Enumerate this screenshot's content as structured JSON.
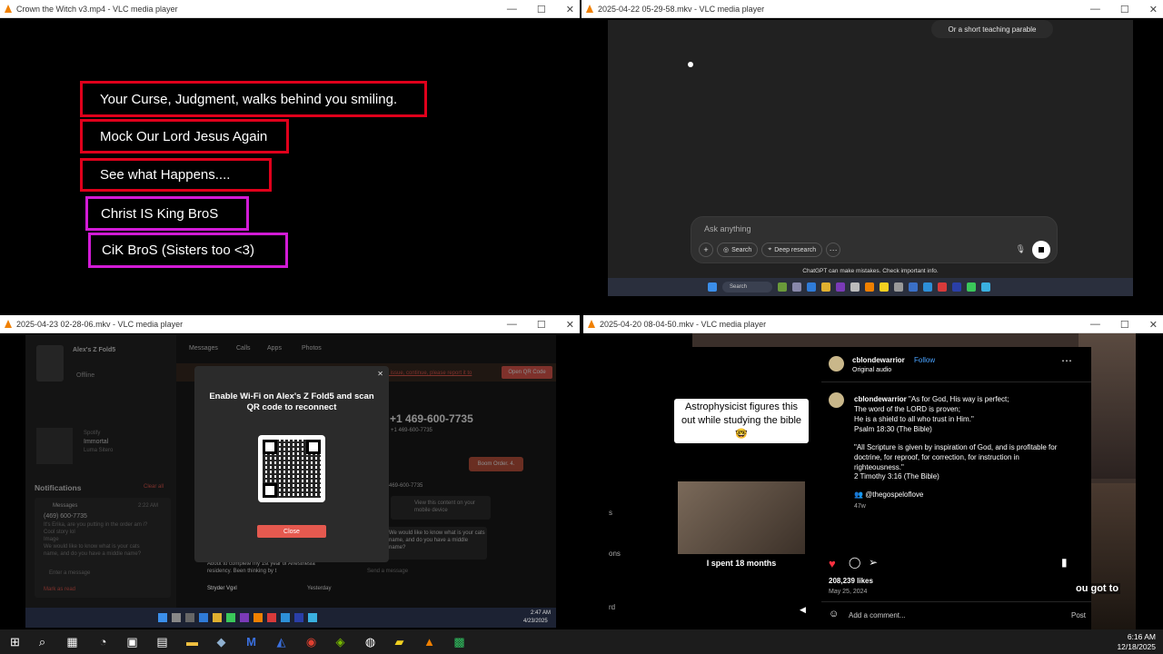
{
  "windows": {
    "w1": {
      "title": "Crown the Witch v3.mp4 - VLC media player",
      "lines": [
        "Your Curse, Judgment, walks behind you smiling.",
        "Mock Our Lord Jesus Again",
        "See what Happens....",
        "Christ IS King BroS",
        "CiK BroS (Sisters too <3)"
      ]
    },
    "w2": {
      "title": "2025-04-22 05-29-58.mkv - VLC media player",
      "tooltip": "Or a short teaching parable",
      "ask_placeholder": "Ask anything",
      "search_label": "Search",
      "deep_research_label": "Deep research",
      "disclaimer": "ChatGPT can make mistakes. Check important info.",
      "taskbar_search": "Search"
    },
    "w3": {
      "title": "2025-04-23 02-28-06.mkv - VLC media player",
      "device_name": "Alex's Z Fold5",
      "status": "Offline",
      "tabs": [
        "Messages",
        "Calls",
        "Apps",
        "Photos"
      ],
      "now_playing_source": "Spotify",
      "now_playing_title": "Immortal",
      "now_playing_artist": "Luma Sitero",
      "notifications_header": "Notifications",
      "clear_all": "Clear all",
      "notif_app": "Messages",
      "notif_time": "2:22 AM",
      "notif_sender": "(469) 600-7735",
      "notif_lines": [
        "It's Erika, are you putting in the order am i?",
        "Cool story lol",
        "Image",
        "We would like to know what is your cats",
        "name, and do you have a middle name?"
      ],
      "enter_message": "Enter a message",
      "mark_as_read": "Mark as read",
      "banner_link": "Fix issue, continue, please report it to",
      "qr_button": "Open QR Code",
      "dialog_text": "Enable Wi-Fi on Alex's Z Fold5 and scan QR code to reconnect",
      "dialog_close": "Close",
      "contact_number": "+1 469-600-7735",
      "contact_sub": "+1 469-600-7735",
      "bubble_out": "Boom Order. 4.",
      "sender_label": "469-600-7735",
      "media_hint": "View this content on your mobile device",
      "bubble_in": "We would like to know what is your cats name, and do you have a middle name?",
      "send_placeholder": "Send a message",
      "list_snippet": "About to complete my 1st year of Anesthesia residency. Been thinking by t",
      "list_sender": "Stryder Vgxl",
      "list_time": "Yesterday",
      "clock_time": "2:47 AM",
      "clock_date": "4/23/2025"
    },
    "w4": {
      "title": "2025-04-20 08-04-50.mkv - VLC media player",
      "caption_overlay": "Astrophysicist figures this out while studying the bible🤓",
      "video_caption": "I spent 18 months",
      "username": "cblondewarrior",
      "follow": "Follow",
      "audio": "Original audio",
      "post_lines": [
        "As for God, His way is perfect;",
        "The word of the LORD is proven;",
        "He is a shield to all who trust in Him.\"",
        "Psalm 18:30 (The Bible)",
        "",
        "\"All Scripture is given by inspiration of God, and is profitable for",
        "doctrine, for reproof, for correction, for instruction in",
        "righteousness.\"",
        "2 Timothy 3:16 (The Bible)"
      ],
      "mention": "@thegospeloflove",
      "age": "47w",
      "likes": "208,239 likes",
      "date": "May 25, 2024",
      "comment_placeholder": "Add a comment...",
      "post_button": "Post",
      "side_text": "ou got to",
      "left_fragments": [
        "s",
        "ons",
        "rd"
      ]
    }
  },
  "taskbar": {
    "time": "6:16 AM",
    "date": "12/18/2025"
  }
}
